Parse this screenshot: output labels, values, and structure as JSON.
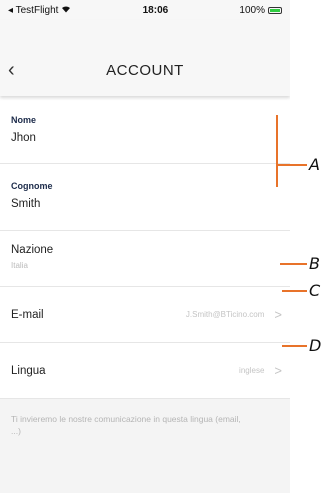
{
  "status_bar": {
    "carrier": "◂ TestFlight",
    "time": "18:06",
    "battery": "100%"
  },
  "nav": {
    "back_icon": "‹",
    "title": "ACCOUNT"
  },
  "fields": {
    "nome_label": "Nome",
    "nome_value": "Jhon",
    "cognome_label": "Cognome",
    "cognome_value": "Smith",
    "nazione_label": "Nazione",
    "nazione_value": "Italia",
    "email_label": "E-mail",
    "email_value": "J.Smith@BTicino.com",
    "lingua_label": "Lingua",
    "lingua_value": "inglese"
  },
  "footer_note": "Ti invieremo le nostre comunicazione in questa lingua (email, ...)",
  "annotations": {
    "a": "A",
    "b": "B",
    "c": "C",
    "d": "D"
  },
  "colors": {
    "accent": "#e8732a",
    "label_dark": "#1c2b4a"
  }
}
